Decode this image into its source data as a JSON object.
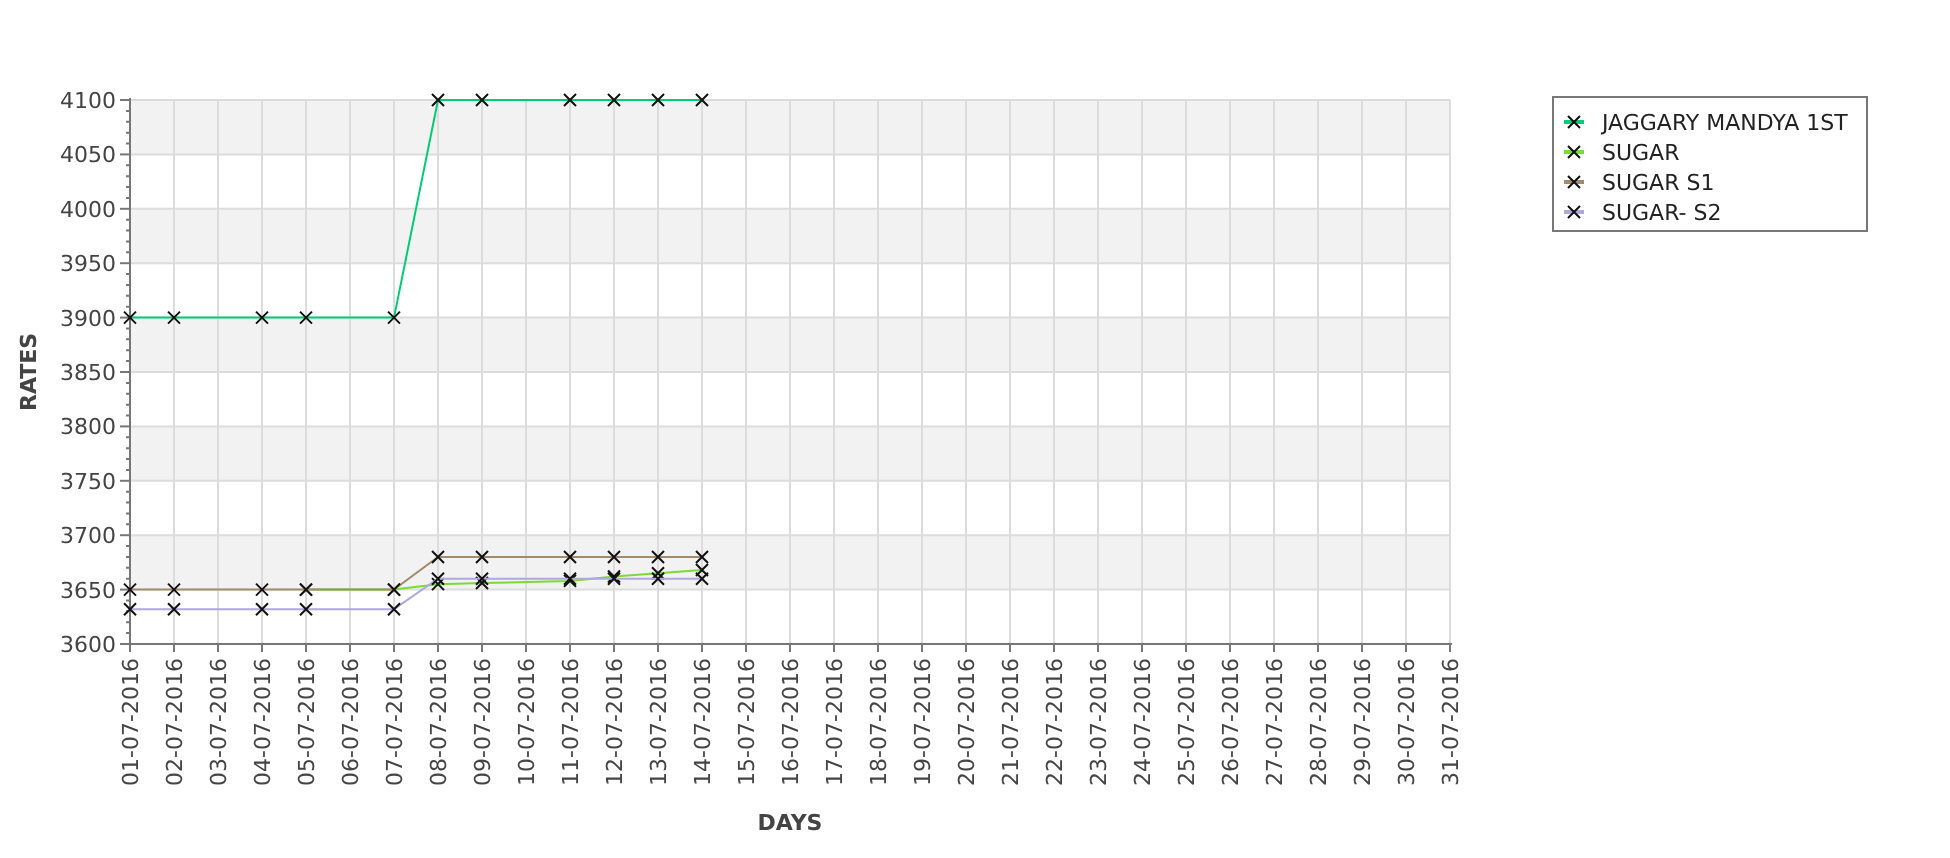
{
  "chart_data": {
    "type": "line",
    "xlabel": "DAYS",
    "ylabel": "RATES",
    "x": [
      "01-07-2016",
      "02-07-2016",
      "03-07-2016",
      "04-07-2016",
      "05-07-2016",
      "06-07-2016",
      "07-07-2016",
      "08-07-2016",
      "09-07-2016",
      "10-07-2016",
      "11-07-2016",
      "12-07-2016",
      "13-07-2016",
      "14-07-2016",
      "15-07-2016",
      "16-07-2016",
      "17-07-2016",
      "18-07-2016",
      "19-07-2016",
      "20-07-2016",
      "21-07-2016",
      "22-07-2016",
      "23-07-2016",
      "24-07-2016",
      "25-07-2016",
      "26-07-2016",
      "27-07-2016",
      "28-07-2016",
      "29-07-2016",
      "30-07-2016",
      "31-07-2016"
    ],
    "ylim": [
      3600,
      4100
    ],
    "grid": true,
    "legend": true,
    "yticks": [
      3600,
      3650,
      3700,
      3750,
      3800,
      3850,
      3900,
      3950,
      4000,
      4050,
      4100
    ],
    "series": [
      {
        "name": "JAGGARY MANDYA 1ST",
        "color": "#00cc77",
        "marker": "x",
        "values": [
          3900,
          3900,
          null,
          3900,
          3900,
          null,
          3900,
          4100,
          4100,
          null,
          4100,
          4100,
          4100,
          4100,
          null,
          null,
          null,
          null,
          null,
          null,
          null,
          null,
          null,
          null,
          null,
          null,
          null,
          null,
          null,
          null,
          null
        ]
      },
      {
        "name": "SUGAR",
        "color": "#77dd33",
        "marker": "x",
        "values": [
          null,
          null,
          null,
          null,
          3650,
          null,
          3650,
          3655,
          3656,
          null,
          3658,
          3662,
          3665,
          3668,
          null,
          null,
          null,
          null,
          null,
          null,
          null,
          null,
          null,
          null,
          null,
          null,
          null,
          null,
          null,
          null,
          null
        ]
      },
      {
        "name": "SUGAR S1",
        "color": "#a08b6e",
        "marker": "x",
        "values": [
          3650,
          3650,
          null,
          3650,
          3650,
          null,
          3650,
          3680,
          3680,
          null,
          3680,
          3680,
          3680,
          3680,
          null,
          null,
          null,
          null,
          null,
          null,
          null,
          null,
          null,
          null,
          null,
          null,
          null,
          null,
          null,
          null,
          null
        ]
      },
      {
        "name": "SUGAR- S2",
        "color": "#b0a8dd",
        "marker": "x",
        "values": [
          3632,
          3632,
          null,
          3632,
          3632,
          null,
          3632,
          3660,
          3660,
          null,
          3660,
          3660,
          3660,
          3660,
          null,
          null,
          null,
          null,
          null,
          null,
          null,
          null,
          null,
          null,
          null,
          null,
          null,
          null,
          null,
          null,
          null
        ]
      }
    ]
  }
}
